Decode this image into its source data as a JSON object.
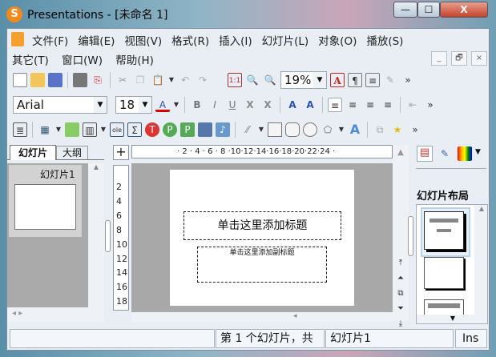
{
  "window": {
    "title": "Presentations - [未命名 1]",
    "logo": "S",
    "min": "—",
    "max": "☐",
    "close": "X"
  },
  "menu": {
    "row1": [
      "文件(F)",
      "编辑(E)",
      "视图(V)",
      "格式(R)",
      "插入(I)",
      "幻灯片(L)",
      "对象(O)",
      "播放(S)"
    ],
    "row2": [
      "其它(T)",
      "窗口(W)",
      "帮助(H)"
    ],
    "mdi": [
      "_",
      "🗗",
      "×"
    ]
  },
  "toolbar": {
    "zoom": "19%",
    "font": "Arial",
    "size": "18",
    "more": "»"
  },
  "tabs": [
    "幻灯片",
    "大纲"
  ],
  "thumb_label": "幻灯片1",
  "hruler": "· 2 · 4 · 6 · 8 ·10·12·14·16·18·20·22·24 ·",
  "vruler": [
    "2",
    "4",
    "6",
    "8",
    "10",
    "12",
    "14",
    "16",
    "18"
  ],
  "slide": {
    "title_placeholder": "单击这里添加标题",
    "subtitle_placeholder": "单击这里添加副标题"
  },
  "right_panel": {
    "heading": "幻灯片布局"
  },
  "status": {
    "position": "第 1 个幻灯片，共",
    "slide_name": "幻灯片1",
    "mode": "Ins"
  }
}
